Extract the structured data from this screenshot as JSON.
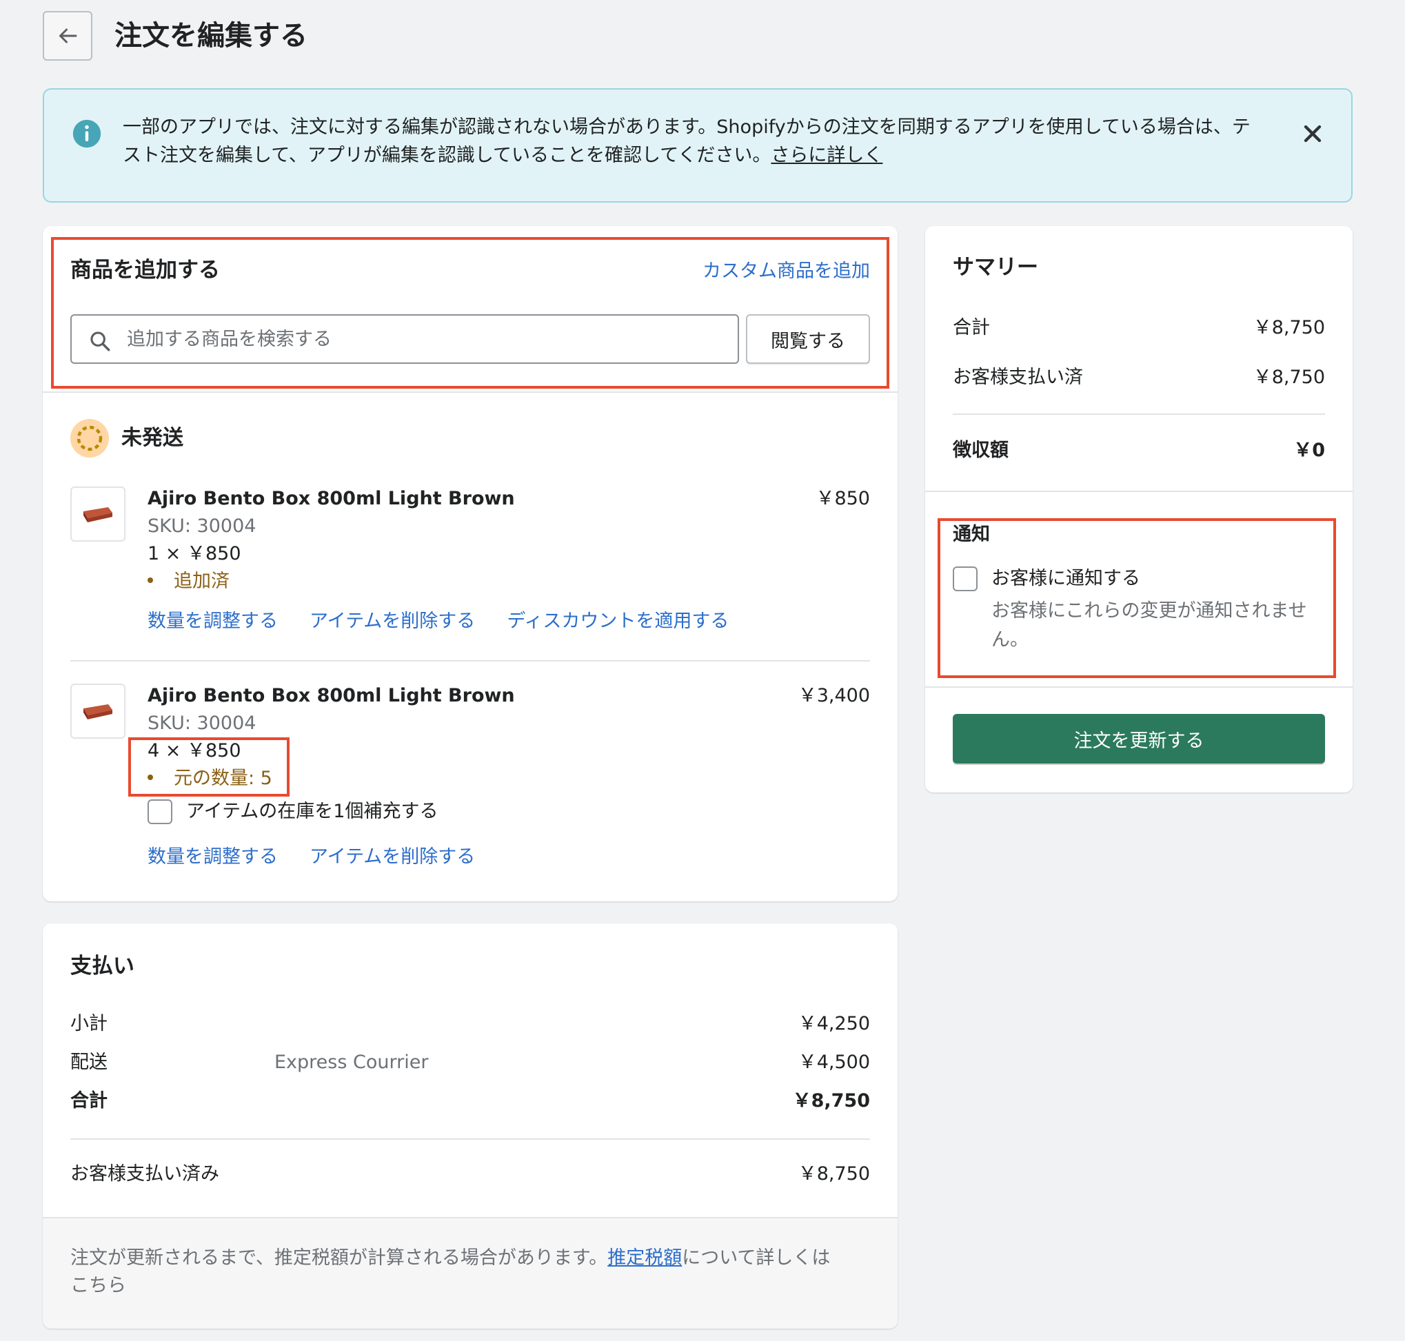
{
  "header": {
    "back_icon": "arrow-left-icon",
    "title": "注文を編集する"
  },
  "banner": {
    "icon": "info-icon",
    "text_line1": "一部のアプリでは、注文に対する編集が認識されない場合があります。Shopifyからの注文を同期するアプリを使用している場合は、テ",
    "text_line2": "スト注文を編集して、アプリが編集を認識していることを確認してください。",
    "link_text": "さらに詳しく",
    "close_icon": "close-icon",
    "accent_color": "#47a5b8"
  },
  "add_product": {
    "title": "商品を追加する",
    "custom_link": "カスタム商品を追加",
    "search_placeholder": "追加する商品を検索する",
    "search_value": "",
    "browse_label": "閲覧する"
  },
  "fulfillment": {
    "status_label": "未発送",
    "status_icon": "unfulfilled-icon",
    "items": [
      {
        "title": "Ajiro Bento Box 800ml Light Brown",
        "sku": "SKU: 30004",
        "qty_price": "1 × ￥850",
        "badge": "追加済",
        "total": "￥850",
        "actions": [
          "数量を調整する",
          "アイテムを削除する",
          "ディスカウントを適用する"
        ]
      },
      {
        "title": "Ajiro Bento Box 800ml Light Brown",
        "sku": "SKU: 30004",
        "qty_price": "4 × ￥850",
        "badge": "元の数量: 5",
        "total": "￥3,400",
        "restock_label": "アイテムの在庫を1個補充する",
        "actions": [
          "数量を調整する",
          "アイテムを削除する"
        ]
      }
    ]
  },
  "payment": {
    "title": "支払い",
    "subtotal_label": "小計",
    "subtotal_value": "￥4,250",
    "shipping_label": "配送",
    "shipping_method": "Express Courrier",
    "shipping_value": "￥4,500",
    "total_label": "合計",
    "total_value": "￥8,750",
    "paid_label": "お客様支払い済み",
    "paid_value": "￥8,750",
    "footer_text": "注文が更新されるまで、推定税額が計算される場合があります。",
    "footer_link": "推定税額",
    "footer_text2": "について詳しくは",
    "footer_text3": "こちら"
  },
  "summary": {
    "title": "サマリー",
    "total_label": "合計",
    "total_value": "￥8,750",
    "paid_label": "お客様支払い済",
    "paid_value": "￥8,750",
    "balance_label": "徴収額",
    "balance_value": "￥0"
  },
  "notification": {
    "title": "通知",
    "checkbox_label": "お客様に通知する",
    "help_line1": "お客様にこれらの変更が通知されませ",
    "help_line2": "ん。",
    "checked": false
  },
  "update_button": "注文を更新する",
  "colors": {
    "primary_button": "#2b7a5e",
    "link": "#2c6ecb",
    "highlight_outline": "#e84a2f",
    "badge_text": "#8a6116"
  }
}
